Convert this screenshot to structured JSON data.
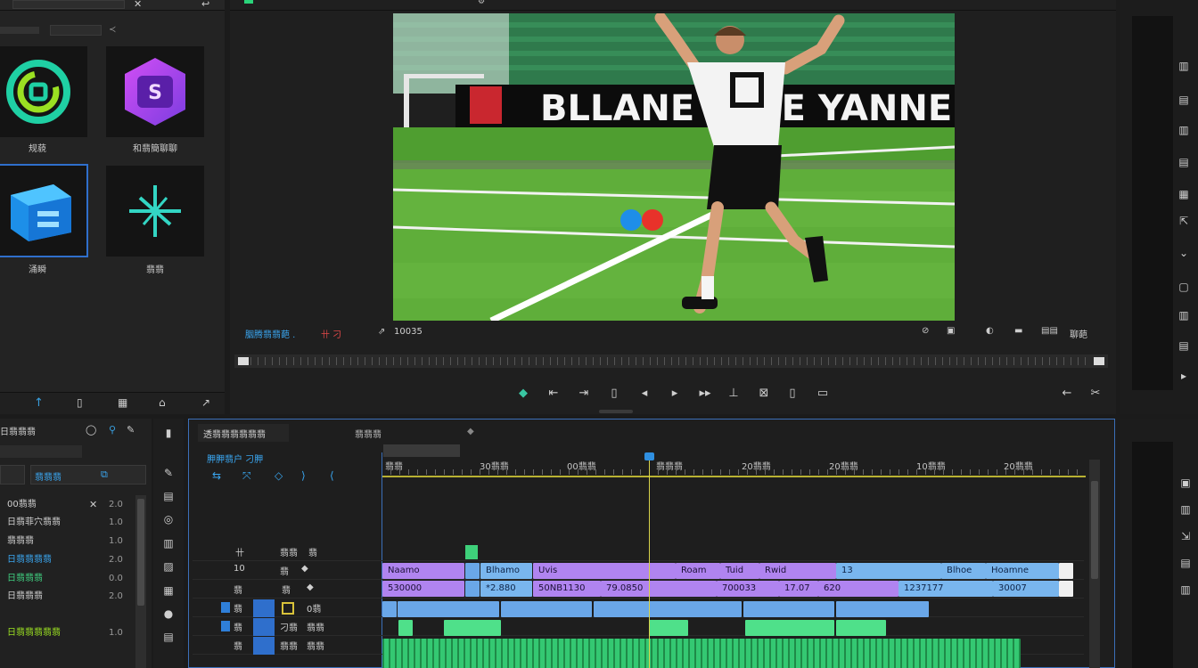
{
  "colors": {
    "accent_blue": "#2f6fcc",
    "accent_teal": "#39c6a2",
    "playhead_yellow": "#d8d34a",
    "clip_purple": "#b084f0",
    "clip_blue": "#6aa7e8",
    "clip_green": "#4fe08a"
  },
  "project": {
    "thumbs": [
      {
        "label": "规藐",
        "icon": "spiral-logo-icon"
      },
      {
        "label": "和翡簡聊聊",
        "icon": "s-logo-icon"
      },
      {
        "label": "涌瞬",
        "icon": "cube-logo-icon"
      },
      {
        "label": "翡翡",
        "icon": "cross-logo-icon"
      }
    ]
  },
  "monitor": {
    "left_label": "胭腾翡翡葩 .",
    "mid_label": "卄 刁",
    "timecode": "10035",
    "right_label": "聊葩",
    "banner_text": "BLLANE YAFE YANNE"
  },
  "effects": {
    "header": "日翡翡翡",
    "search_label": "翡翡翡",
    "rows": [
      {
        "name": "00翡翡",
        "value": "2.0"
      },
      {
        "name": "日翡菲穴翡翡",
        "value": "1.0"
      },
      {
        "name": "翡翡翡",
        "value": "1.0"
      },
      {
        "name": "日翡翡翡翡",
        "value": "2.0"
      },
      {
        "name": "日翡翡翡",
        "value": "0.0"
      },
      {
        "name": "日翡翡翡",
        "value": "2.0"
      },
      {
        "name": "日翡翡翡翡翡",
        "value": "1.0"
      }
    ]
  },
  "timeline": {
    "tab_label": "透翡翡翡翡翡翡",
    "tab2_label": "翡翡翡",
    "track_header_title": "胛胛翡户 刁胛",
    "ruler_labels": [
      "翡翡",
      "30翡翡",
      "00翡翡",
      "翡翡翡",
      "20翡翡",
      "20翡翡",
      "10翡翡",
      "20翡翡"
    ],
    "tracks": [
      {
        "a": "卄",
        "b": "翡翡",
        "c": "翡"
      },
      {
        "a": "10",
        "b": "翡",
        "c": "◆"
      },
      {
        "a": "翡",
        "b": "翡",
        "c": "◆"
      },
      {
        "a": "翡",
        "b": "翡",
        "c": "0翡"
      },
      {
        "a": "翡",
        "b": "刁翡",
        "c": "翡翡"
      },
      {
        "a": "翡",
        "b": "翡翡",
        "c": "翡翡"
      }
    ],
    "clips_row1": [
      "Naamo",
      "Blhamo",
      "Uvis",
      "Roam",
      "Tuid",
      "Rwid",
      "13",
      "Blhoe",
      "Hoamne"
    ],
    "clips_row2": [
      "530000",
      "*2.880",
      "50NB1130",
      "79.0850",
      "700033",
      "17.07",
      "620",
      "1237177",
      "30007"
    ]
  }
}
